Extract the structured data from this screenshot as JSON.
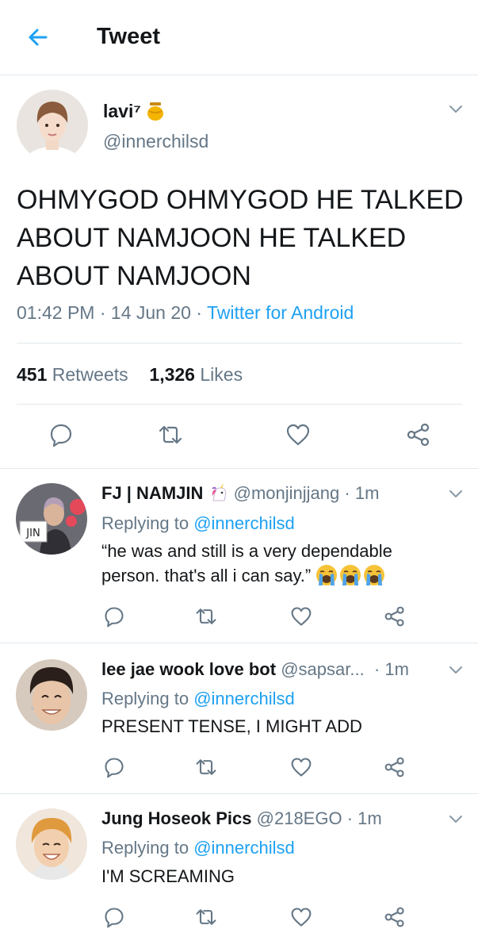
{
  "header": {
    "title": "Tweet"
  },
  "tweet": {
    "name": "lavi⁷",
    "handle": "@innerchilsd",
    "text": "OHMYGOD OHMYGOD HE TALKED ABOUT NAMJOON HE TALKED ABOUT NAMJOON",
    "time": "01:42 PM",
    "date": "14 Jun 20",
    "source": "Twitter for Android",
    "retweets_count": "451",
    "retweets_label": "Retweets",
    "likes_count": "1,326",
    "likes_label": "Likes"
  },
  "replies": [
    {
      "name": "FJ | NAMJIN",
      "handle": "@monjinjjang",
      "time": "1m",
      "replying_label": "Replying to",
      "replying_to": "@innerchilsd",
      "text": "“he was and still is a very dependable person. that's all i can say.”",
      "avatar_sign": "JIN"
    },
    {
      "name": "lee jae wook love bot",
      "handle": "@sapsar...",
      "time": "1m",
      "replying_label": "Replying to",
      "replying_to": "@innerchilsd",
      "text": "PRESENT TENSE, I MIGHT ADD"
    },
    {
      "name": "Jung Hoseok Pics",
      "handle": "@218EGO",
      "time": "1m",
      "replying_label": "Replying to",
      "replying_to": "@innerchilsd",
      "text": "I'M SCREAMING"
    }
  ],
  "colors": {
    "accent": "#1da1f2",
    "muted": "#657786",
    "text": "#14171a",
    "divider": "#e1e8ed"
  },
  "icons": [
    "back-arrow-icon",
    "honey-jar-icon",
    "chevron-down-icon",
    "reply-icon",
    "retweet-icon",
    "like-icon",
    "share-icon",
    "unicorn-icon",
    "crying-face-icon"
  ]
}
